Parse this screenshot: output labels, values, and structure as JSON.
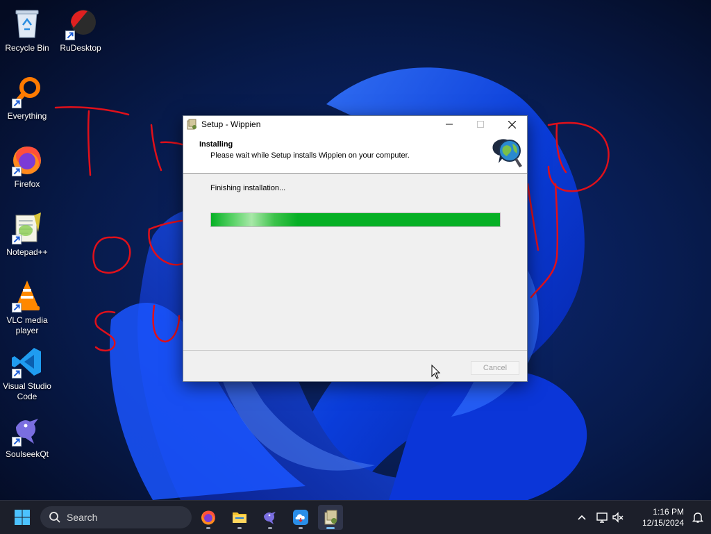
{
  "desktop": {
    "icons": [
      {
        "label": "Recycle Bin",
        "icon": "recycle-bin-icon"
      },
      {
        "label": "RuDesktop",
        "icon": "rudesktop-icon"
      },
      {
        "label": "Everything",
        "icon": "everything-search-icon"
      },
      {
        "label": "Firefox",
        "icon": "firefox-icon"
      },
      {
        "label": "Notepad++",
        "icon": "notepadpp-icon"
      },
      {
        "label": "VLC media player",
        "icon": "vlc-icon"
      },
      {
        "label": "Visual Studio Code",
        "icon": "vscode-icon"
      },
      {
        "label": "SoulseekQt",
        "icon": "soulseek-icon"
      }
    ],
    "scribble_color": "#e0101a"
  },
  "dialog": {
    "title": "Setup - Wippien",
    "header_title": "Installing",
    "header_subtitle": "Please wait while Setup installs Wippien on your computer.",
    "status_text": "Finishing installation...",
    "progress": 1.0,
    "cancel_label": "Cancel",
    "cancel_enabled": false,
    "progress_color": "#06b025"
  },
  "taskbar": {
    "search_placeholder": "Search",
    "apps": [
      "windows-start-icon",
      "firefox-icon",
      "file-explorer-icon",
      "soulseek-icon",
      "cloud-app-icon",
      "setup-installer-icon"
    ],
    "clock_time": "1:16 PM",
    "clock_date": "12/15/2024"
  }
}
